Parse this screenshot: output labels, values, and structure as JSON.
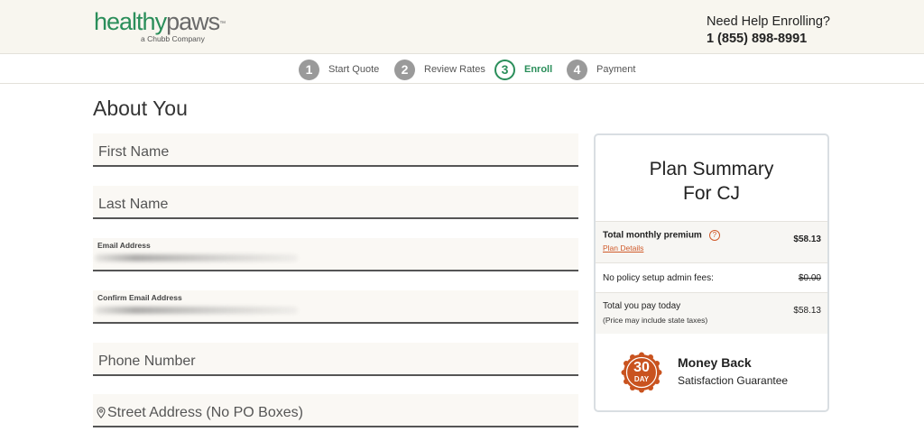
{
  "header": {
    "logo_part1": "healthy",
    "logo_part2": "paws",
    "logo_tm": "™",
    "logo_sub": "a Chubb Company",
    "help_title": "Need Help Enrolling?",
    "help_phone": "1 (855) 898-8991"
  },
  "steps": [
    {
      "num": "1",
      "label": "Start Quote"
    },
    {
      "num": "2",
      "label": "Review Rates"
    },
    {
      "num": "3",
      "label": "Enroll"
    },
    {
      "num": "4",
      "label": "Payment"
    }
  ],
  "active_step": 3,
  "page_title": "About You",
  "form": {
    "first_name_placeholder": "First Name",
    "last_name_placeholder": "Last Name",
    "email_label": "Email Address",
    "confirm_email_label": "Confirm Email Address",
    "phone_placeholder": "Phone Number",
    "street_placeholder": "Street Address (No PO Boxes)"
  },
  "summary": {
    "title": "Plan Summary For CJ",
    "total_monthly_label": "Total monthly premium",
    "total_monthly_value": "$58.13",
    "plan_details_link": "Plan Details",
    "setup_fee_label": "No policy setup admin fees:",
    "setup_fee_value": "$0.00",
    "total_today_label": "Total you pay today",
    "total_today_note": "(Price may include state taxes)",
    "total_today_value": "$58.13",
    "badge_number": "30",
    "badge_unit": "DAY",
    "guarantee_title": "Money Back",
    "guarantee_sub": "Satisfaction Guarantee"
  },
  "colors": {
    "brand_green": "#2a8e5a",
    "accent_orange": "#d05a2a",
    "strike_red": "#d9352b"
  }
}
